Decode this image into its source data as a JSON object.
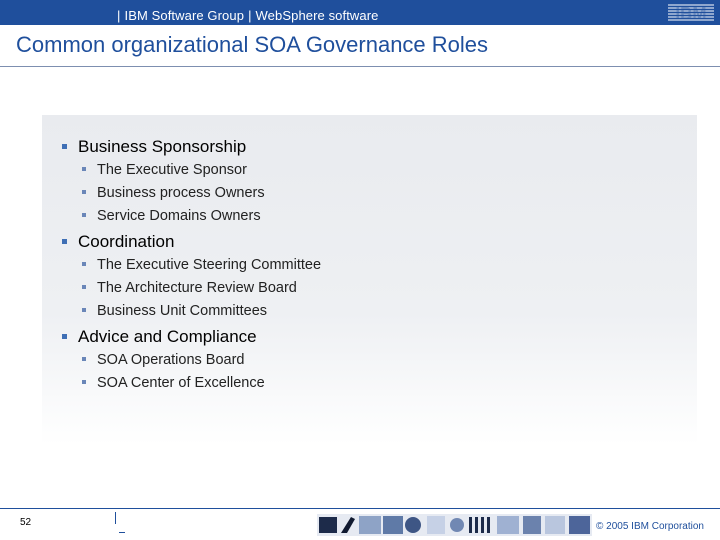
{
  "header": {
    "left": "IBM Software Group",
    "right": "WebSphere software",
    "logo_text": "IBM"
  },
  "slide": {
    "title": "Common organizational SOA Governance Roles",
    "sections": [
      {
        "label": "Business Sponsorship",
        "items": [
          "The Executive Sponsor",
          "Business process Owners",
          "Service Domains Owners"
        ]
      },
      {
        "label": "Coordination",
        "items": [
          "The Executive Steering Committee",
          "The Architecture Review Board",
          "Business Unit Committees"
        ]
      },
      {
        "label": "Advice and Compliance",
        "items": [
          "SOA Operations Board",
          "SOA Center of Excellence"
        ]
      }
    ]
  },
  "footer": {
    "page_number": "52",
    "copyright": "© 2005 IBM Corporation"
  },
  "colors": {
    "brand_blue": "#1f4f9c",
    "bullet_blue": "#3f6fb5"
  }
}
